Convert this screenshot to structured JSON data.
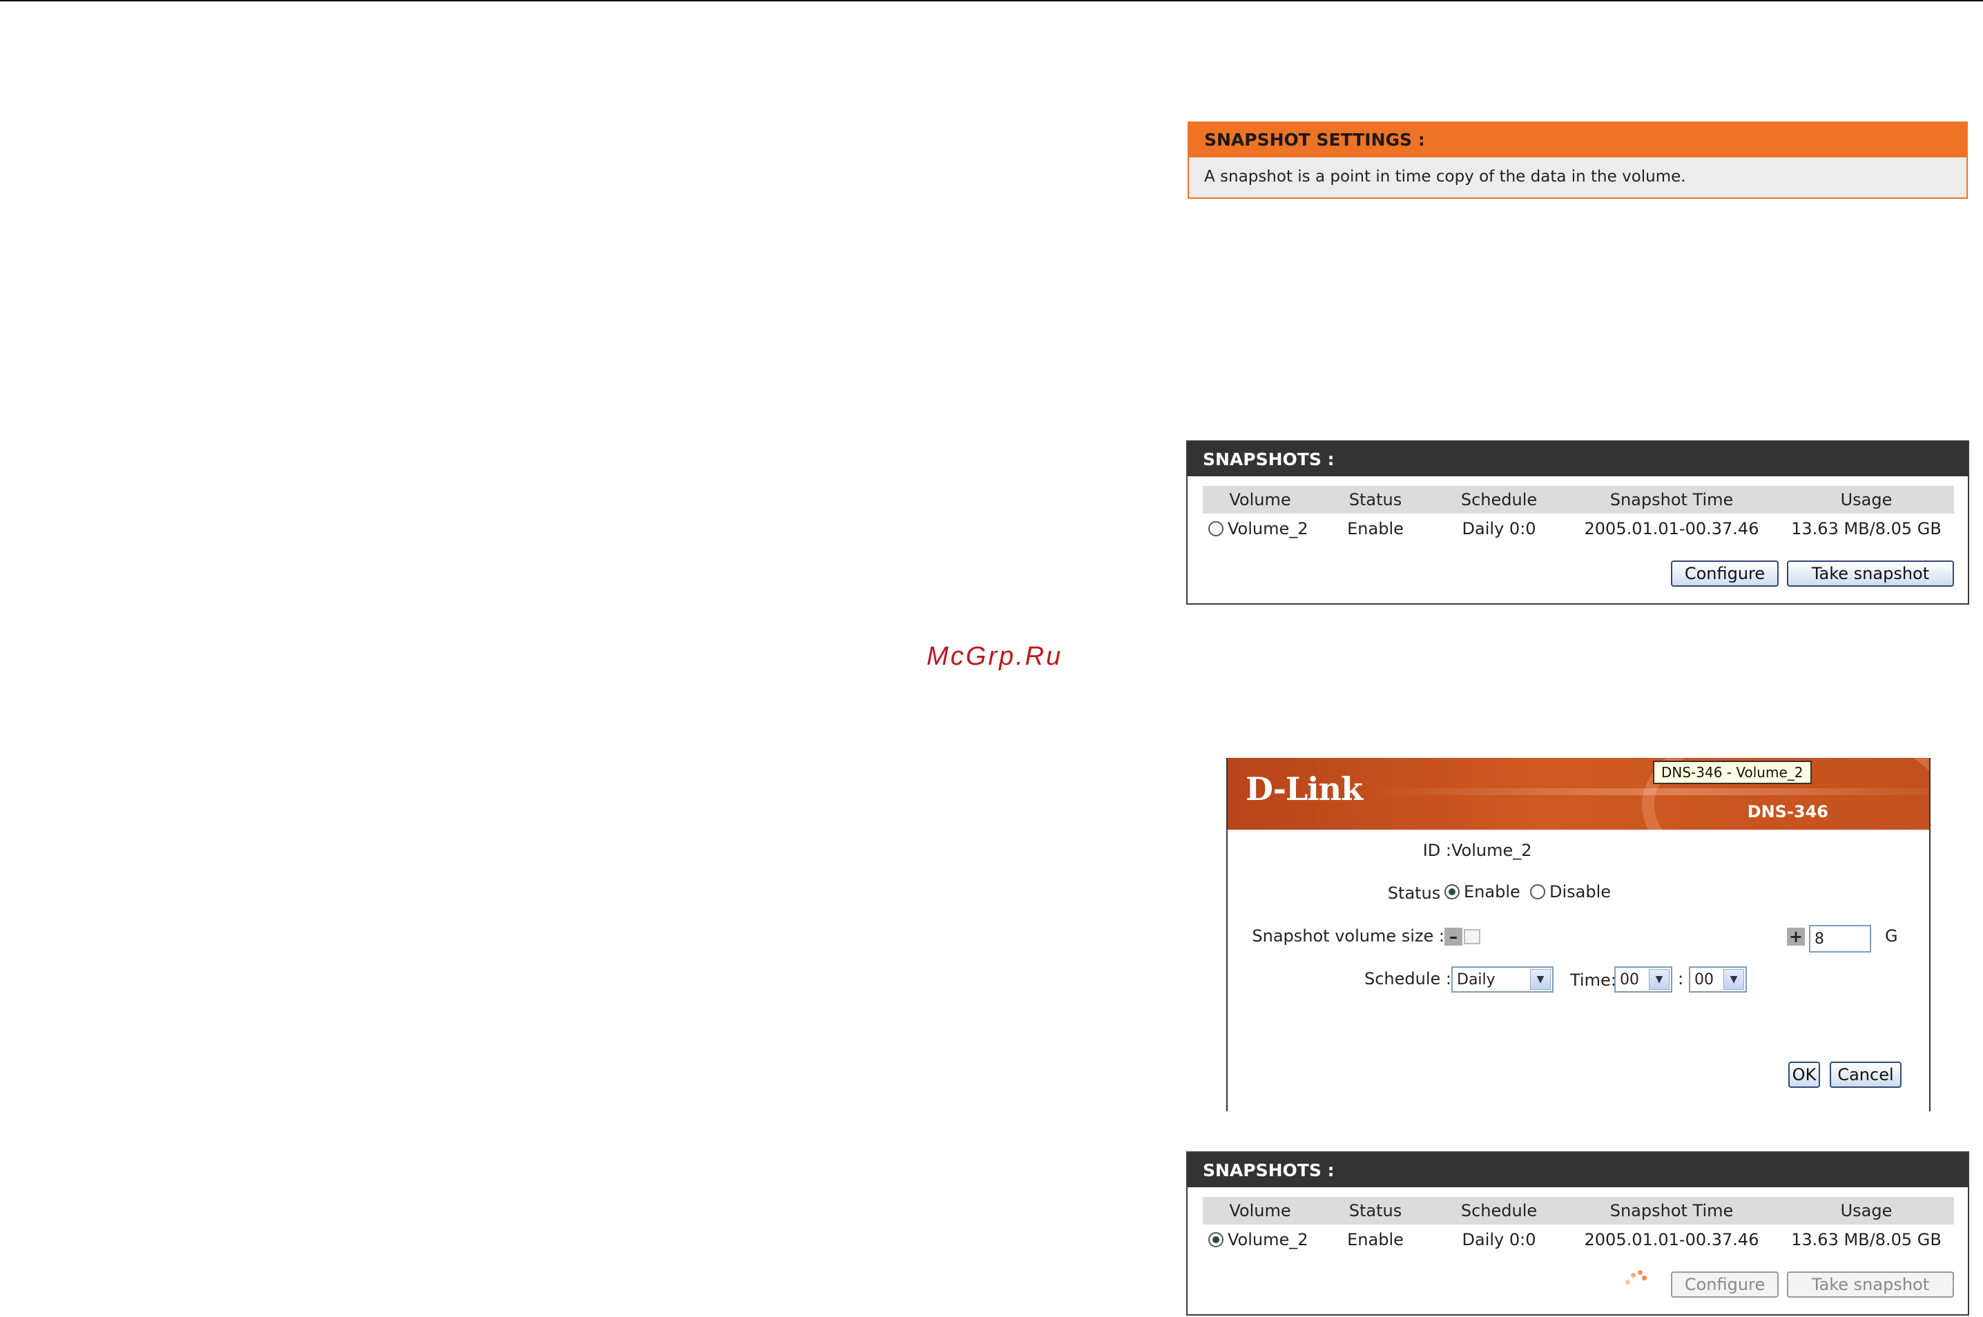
{
  "watermark": "McGrp.Ru",
  "settings": {
    "title": "SNAPSHOT SETTINGS :",
    "description": "A snapshot is a point in time copy of the data in the volume."
  },
  "columns": [
    "Volume",
    "Status",
    "Schedule",
    "Snapshot Time",
    "Usage"
  ],
  "snapshots_top": {
    "title": "SNAPSHOTS :",
    "row": {
      "volume": "Volume_2",
      "status": "Enable",
      "schedule": "Daily 0:0",
      "time": "2005.01.01-00.37.46",
      "usage": "13.63 MB/8.05 GB",
      "selected": false
    },
    "configure_label": "Configure",
    "take_label": "Take snapshot"
  },
  "dialog": {
    "logo": "D-Link",
    "model": "DNS-346",
    "tooltip": "DNS-346 - Volume_2",
    "id_label": "ID :",
    "id_value": "Volume_2",
    "status_label": "Status :",
    "enable_label": "Enable",
    "disable_label": "Disable",
    "size_label": "Snapshot volume size :",
    "size_value": "8",
    "size_unit": "G",
    "schedule_label": "Schedule :",
    "schedule_value": "Daily",
    "time_label": "Time:",
    "time_hour": "00",
    "time_sep": ":",
    "time_minute": "00",
    "ok_label": "OK",
    "cancel_label": "Cancel"
  },
  "snapshots_bottom": {
    "title": "SNAPSHOTS :",
    "row": {
      "volume": "Volume_2",
      "status": "Enable",
      "schedule": "Daily 0:0",
      "time": "2005.01.01-00.37.46",
      "usage": "13.63 MB/8.05 GB",
      "selected": true
    },
    "configure_label": "Configure",
    "take_label": "Take snapshot"
  },
  "colors": {
    "accent_orange": "#ef7326",
    "header_dark": "#333333",
    "button_border": "#2f4b77"
  }
}
